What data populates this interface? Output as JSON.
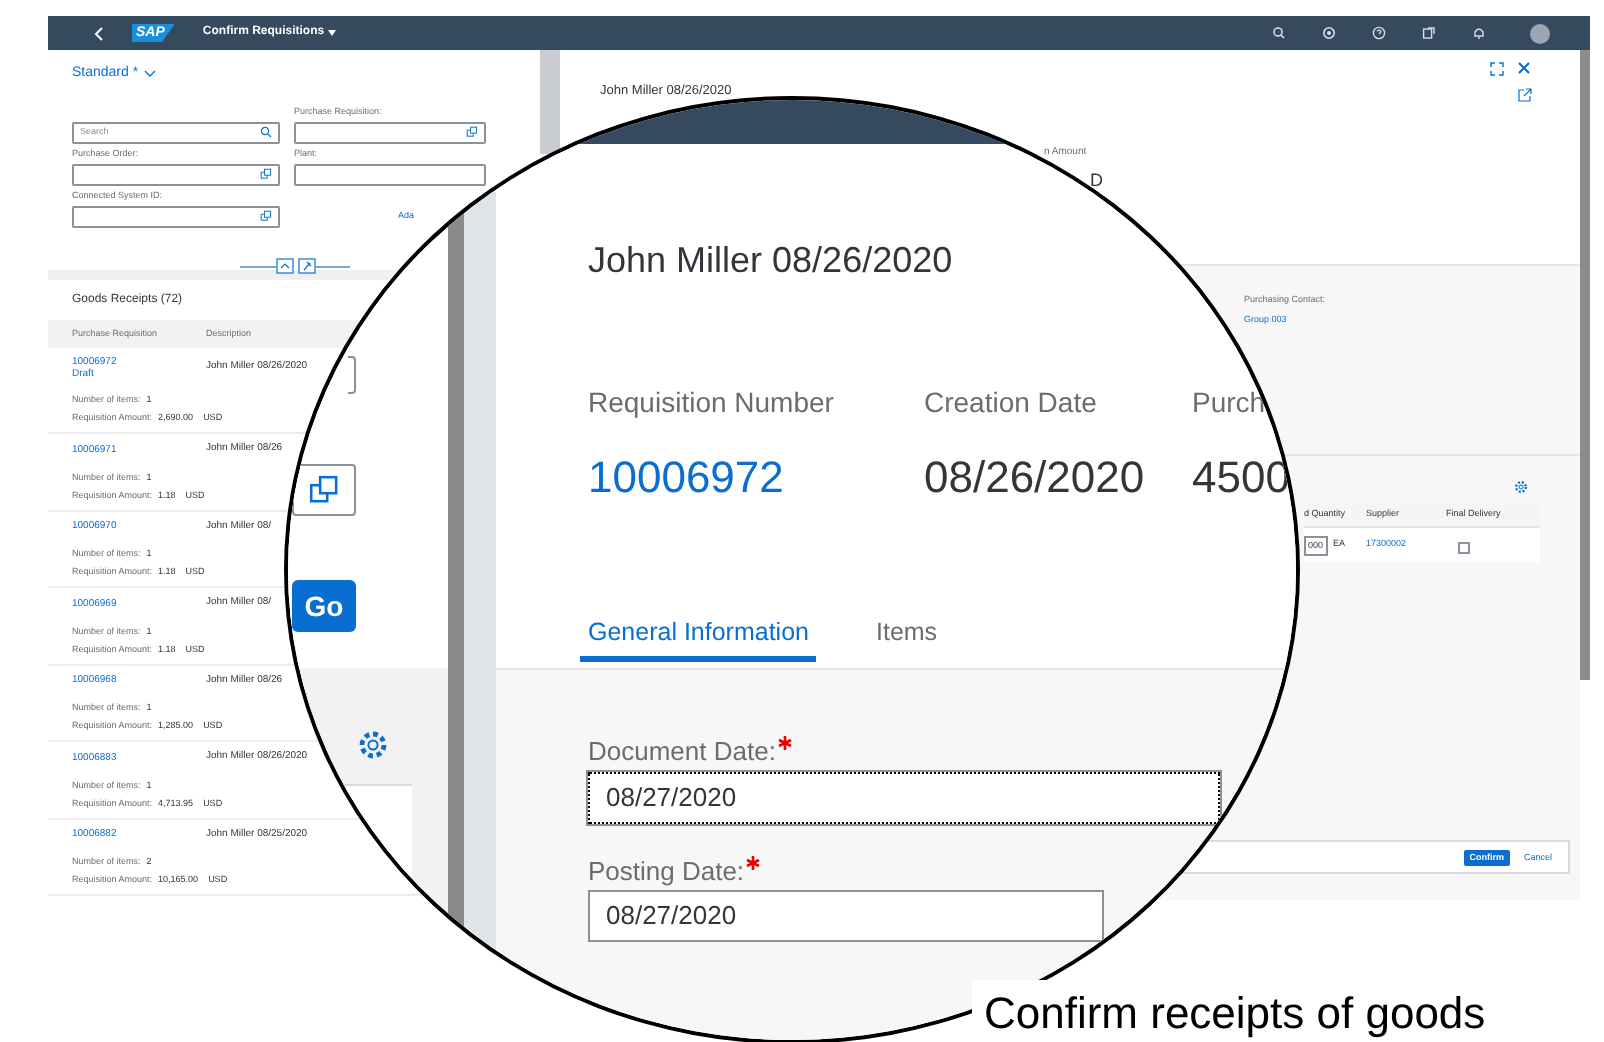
{
  "shell_bar": {
    "logo": "SAP",
    "title": "Confirm Requisitions"
  },
  "filter_bar": {
    "variant": "Standard *",
    "fields": [
      {
        "kind": "search",
        "placeholder": "Search"
      },
      {
        "kind": "value_help",
        "label": "Purchase Requisition:"
      },
      {
        "kind": "value_help",
        "label": "Purchase Order:"
      },
      {
        "kind": "plain",
        "label": "Plant:"
      },
      {
        "kind": "value_help",
        "label": "Connected System ID:"
      }
    ],
    "adapt_link": "Ada"
  },
  "list": {
    "title": "Goods Receipts (72)",
    "columns": [
      "Purchase Requisition",
      "Description"
    ],
    "rows": [
      {
        "id": "10006972",
        "status": "Draft",
        "description": "John Miller 08/26/2020",
        "items_label": "Number of items:",
        "items": "1",
        "amount_label": "Requisition Amount:",
        "amount": "2,690.00",
        "currency": "USD"
      },
      {
        "id": "10006971",
        "description": "John Miller 08/26",
        "items_label": "Number of items:",
        "items": "1",
        "amount_label": "Requisition Amount:",
        "amount": "1.18",
        "currency": "USD"
      },
      {
        "id": "10006970",
        "description": "John Miller 08/",
        "items_label": "Number of items:",
        "items": "1",
        "amount_label": "Requisition Amount:",
        "amount": "1.18",
        "currency": "USD"
      },
      {
        "id": "10006969",
        "description": "John Miller 08/",
        "items_label": "Number of items:",
        "items": "1",
        "amount_label": "Requisition Amount:",
        "amount": "1.18",
        "currency": "USD"
      },
      {
        "id": "10006968",
        "description": "John Miller 08/26",
        "items_label": "Number of items:",
        "items": "1",
        "amount_label": "Requisition Amount:",
        "amount": "1,285.00",
        "currency": "USD"
      },
      {
        "id": "10006883",
        "description": "John Miller 08/26/2020",
        "items_label": "Number of items:",
        "items": "1",
        "amount_label": "Requisition Amount:",
        "amount": "4,713.95",
        "currency": "USD"
      },
      {
        "id": "10006882",
        "description": "John Miller 08/25/2020",
        "items_label": "Number of items:",
        "items": "2",
        "amount_label": "Requisition Amount:",
        "amount": "10,165.00",
        "currency": "USD"
      }
    ]
  },
  "detail": {
    "title": "John Miller 08/26/2020",
    "amount_label_fragment": "n Amount",
    "amount_fragment": "D",
    "contact_label": "Purchasing Contact:",
    "contact": "Group 003",
    "table": {
      "columns": [
        "d Quantity",
        "Supplier",
        "Final Delivery"
      ],
      "rows": [
        {
          "quantity": "000",
          "unit": "EA",
          "supplier": "17300002",
          "final_delivery": false
        }
      ]
    }
  },
  "footer": {
    "buttons": [
      {
        "label": "Confirm",
        "kind": "emphasized"
      },
      {
        "label": "Cancel",
        "kind": "transparent"
      }
    ]
  },
  "magnifier": {
    "go_button": "Go",
    "title": "John Miller 08/26/2020",
    "header_fields": [
      {
        "label": "Requisition Number",
        "value": "10006972",
        "kind": "link"
      },
      {
        "label": "Creation Date",
        "value": "08/26/2020",
        "kind": "text"
      },
      {
        "label": "Purch",
        "value": "4500",
        "kind": "text"
      }
    ],
    "tabs": [
      {
        "label": "General Information",
        "selected": true
      },
      {
        "label": "Items",
        "selected": false
      }
    ],
    "form": [
      {
        "label": "Document Date:",
        "required": true,
        "value": "08/27/2020",
        "focused": true
      },
      {
        "label": "Posting Date:",
        "required": true,
        "value": "08/27/2020",
        "focused": false
      }
    ]
  },
  "caption": "Confirm receipts of goods"
}
